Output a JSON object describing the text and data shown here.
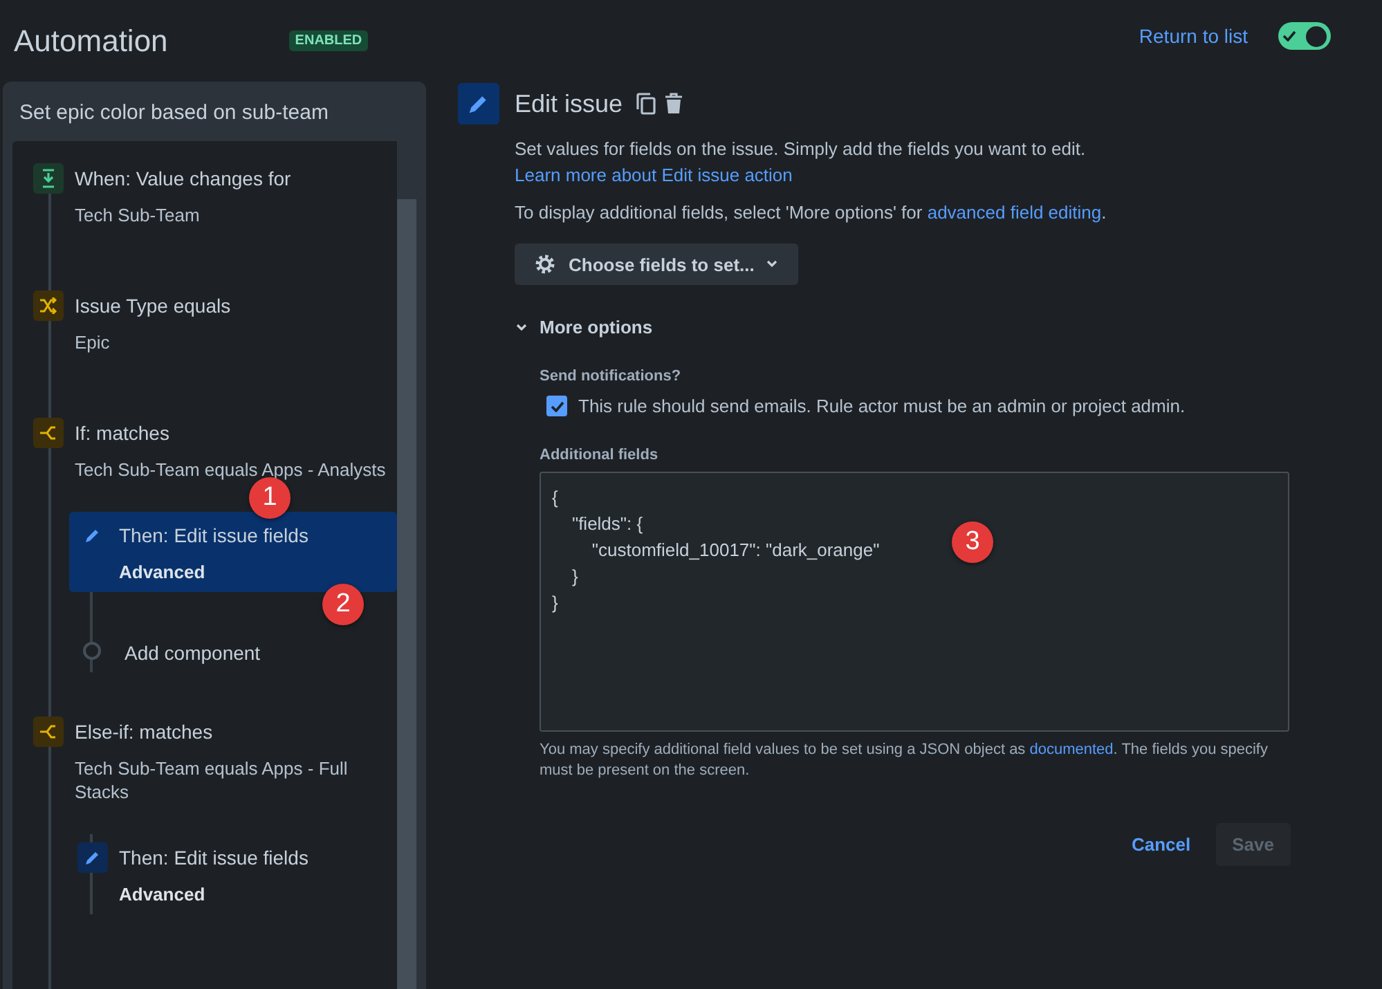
{
  "header": {
    "title": "Automation",
    "status_badge": "ENABLED",
    "return_link": "Return to list",
    "toggle": {
      "on": true
    }
  },
  "rule": {
    "name": "Set epic color based on sub-team",
    "components": [
      {
        "kind": "trigger",
        "title": "When: Value changes for",
        "detail": "Tech Sub-Team",
        "selected": false
      },
      {
        "kind": "condition",
        "title": "Issue Type equals",
        "detail": "Epic",
        "selected": false
      },
      {
        "kind": "branch",
        "title": "If: matches",
        "detail": "Tech Sub-Team equals Apps - Analysts",
        "selected": false,
        "children": [
          {
            "kind": "action",
            "title": "Then: Edit issue fields",
            "detail": "Advanced",
            "selected": true
          },
          {
            "kind": "add",
            "title": "Add component",
            "selected": false
          }
        ]
      },
      {
        "kind": "branch",
        "title": "Else-if: matches",
        "detail": "Tech Sub-Team equals Apps - Full Stacks",
        "selected": false,
        "children": [
          {
            "kind": "action",
            "title": "Then: Edit issue fields",
            "detail": "Advanced",
            "selected": false
          }
        ]
      }
    ]
  },
  "editor": {
    "title": "Edit issue",
    "description": "Set values for fields on the issue. Simply add the fields you want to edit.",
    "description_link": "Learn more about Edit issue action",
    "hint": "To display additional fields, select 'More options' for",
    "hint_link": "advanced field editing",
    "hint_end": ".",
    "choose_button": "Choose fields to set...",
    "more_options": {
      "label": "More options",
      "expanded": true
    },
    "notifications_label": "Send notifications?",
    "notify": {
      "label": "This rule should send emails. Rule actor must be an admin or project admin.",
      "checked": true
    },
    "additional_label": "Additional fields",
    "json_lines": [
      "{",
      "\t\"fields\": {",
      "\t\t\"customfield_10017\": \"dark_orange\"",
      "\t}",
      "}"
    ],
    "help": "You may specify additional field values to be set using a JSON object as",
    "help_link": "documented",
    "help_end": ". The fields you specify must be present on the screen.",
    "cancel": "Cancel",
    "save": {
      "label": "Save",
      "disabled": true
    }
  },
  "annotations": [
    "1",
    "2",
    "3"
  ]
}
